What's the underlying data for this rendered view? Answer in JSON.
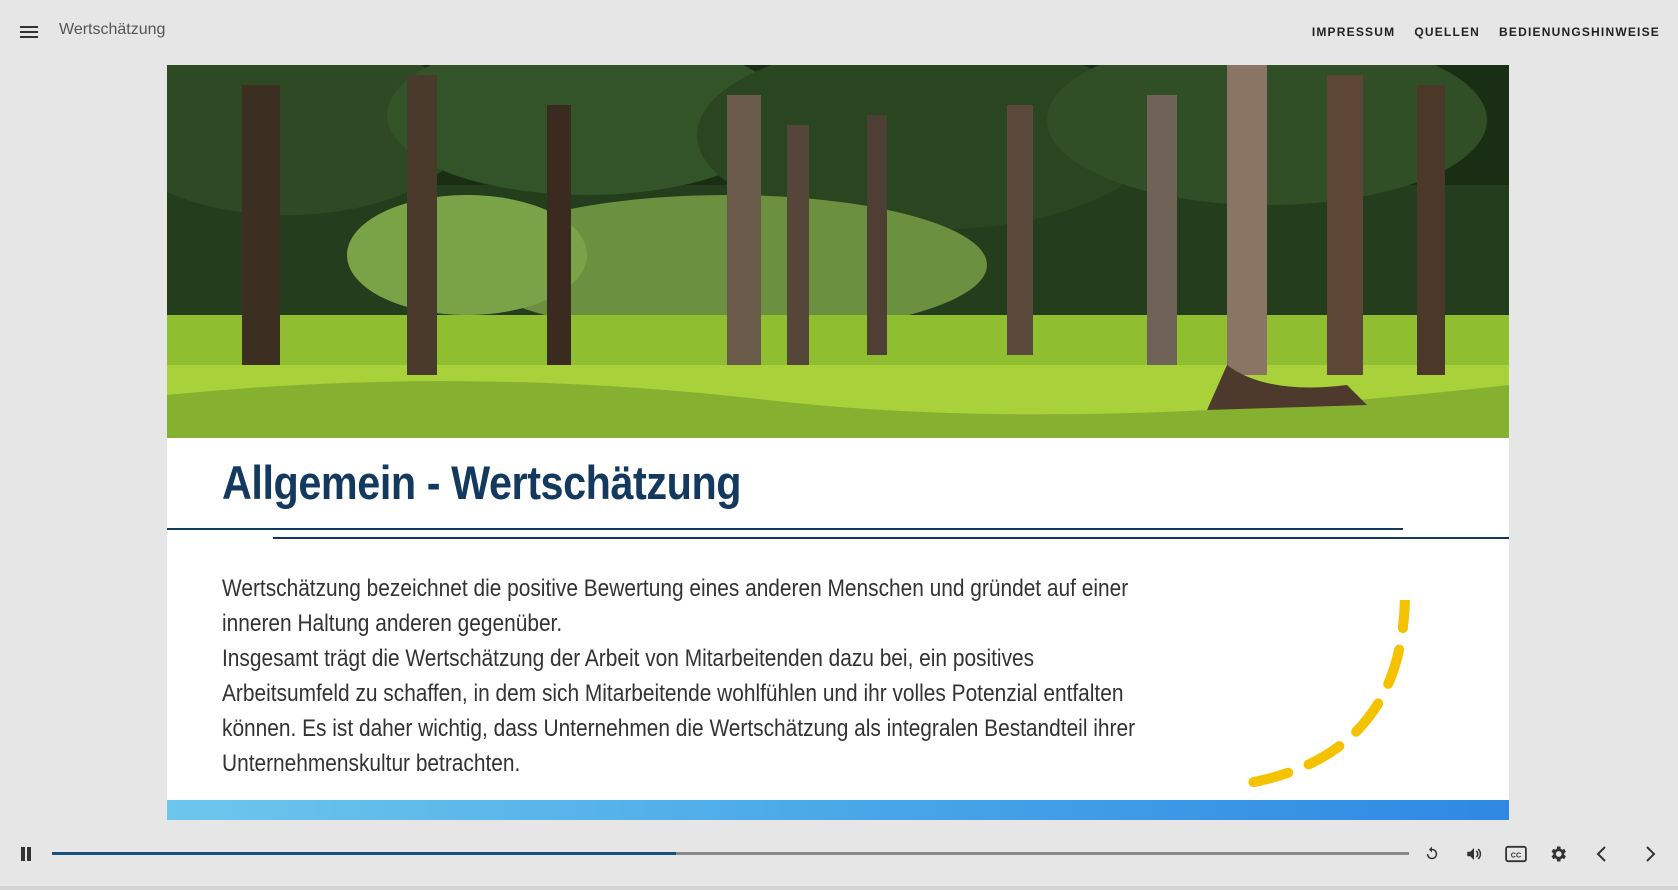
{
  "header": {
    "title": "Wertschätzung",
    "nav": [
      {
        "label": "IMPRESSUM"
      },
      {
        "label": "QUELLEN"
      },
      {
        "label": "BEDIENUNGSHINWEISE"
      }
    ]
  },
  "slide": {
    "title": "Allgemein - Wertschätzung",
    "paragraphs": [
      "Wertschätzung bezeichnet die positive Bewertung eines anderen Menschen und gründet auf einer inneren Haltung anderen gegenüber.",
      "Insgesamt trägt die Wertschätzung der Arbeit von Mitarbeitenden dazu bei, ein positives Arbeitsumfeld zu schaffen, in dem sich Mitarbeitende wohlfühlen und ihr volles Potenzial entfalten können. Es ist daher wichtig, dass Unternehmen die Wertschätzung als integralen  Bestandteil ihrer Unternehmenskultur betrachten."
    ],
    "hero_image": "forest-park-photo",
    "colors": {
      "title": "#13395f",
      "accent_arc": "#f5c200",
      "strip_start": "#6dc6ec",
      "strip_end": "#2f88e3"
    }
  },
  "player": {
    "progress": 0.46,
    "controls": [
      "pause-icon",
      "replay-icon",
      "volume-icon",
      "closed-captions-icon",
      "settings-gear-icon",
      "chevron-left-icon",
      "chevron-right-icon"
    ]
  }
}
